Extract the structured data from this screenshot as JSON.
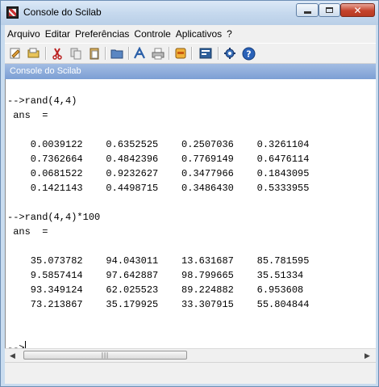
{
  "window": {
    "title": "Console do Scilab"
  },
  "menu": [
    {
      "label": "Arquivo"
    },
    {
      "label": "Editar"
    },
    {
      "label": "Preferências"
    },
    {
      "label": "Controle"
    },
    {
      "label": "Aplicativos"
    },
    {
      "label": "?"
    }
  ],
  "toolbar": {
    "buttons": [
      "new-script-icon",
      "open-file-icon",
      "cut-icon",
      "copy-icon",
      "paste-icon",
      "change-directory-icon",
      "font-icon",
      "print-icon",
      "clear-console-icon",
      "clear-history-icon",
      "module-manager-icon",
      "help-icon"
    ]
  },
  "console": {
    "header": "Console do Scilab",
    "lines": [
      "",
      "-->rand(4,4)",
      " ans  =",
      "",
      "    0.0039122    0.6352525    0.2507036    0.3261104",
      "    0.7362664    0.4842396    0.7769149    0.6476114",
      "    0.0681522    0.9232627    0.3477966    0.1843095",
      "    0.1421143    0.4498715    0.3486430    0.5333955",
      "",
      "-->rand(4,4)*100",
      " ans  =",
      "",
      "    35.073782    94.043011    13.631687    85.781595",
      "    9.5857414    97.642887    98.799665    35.51334",
      "    93.349124    62.025523    89.224882    6.953608",
      "    73.213867    35.179925    33.307915    55.804844",
      "",
      "",
      "-->"
    ]
  },
  "colors": {
    "window_frame": "#c9dcef",
    "console_header": "#7c9fd4",
    "close_button": "#c4432c"
  }
}
